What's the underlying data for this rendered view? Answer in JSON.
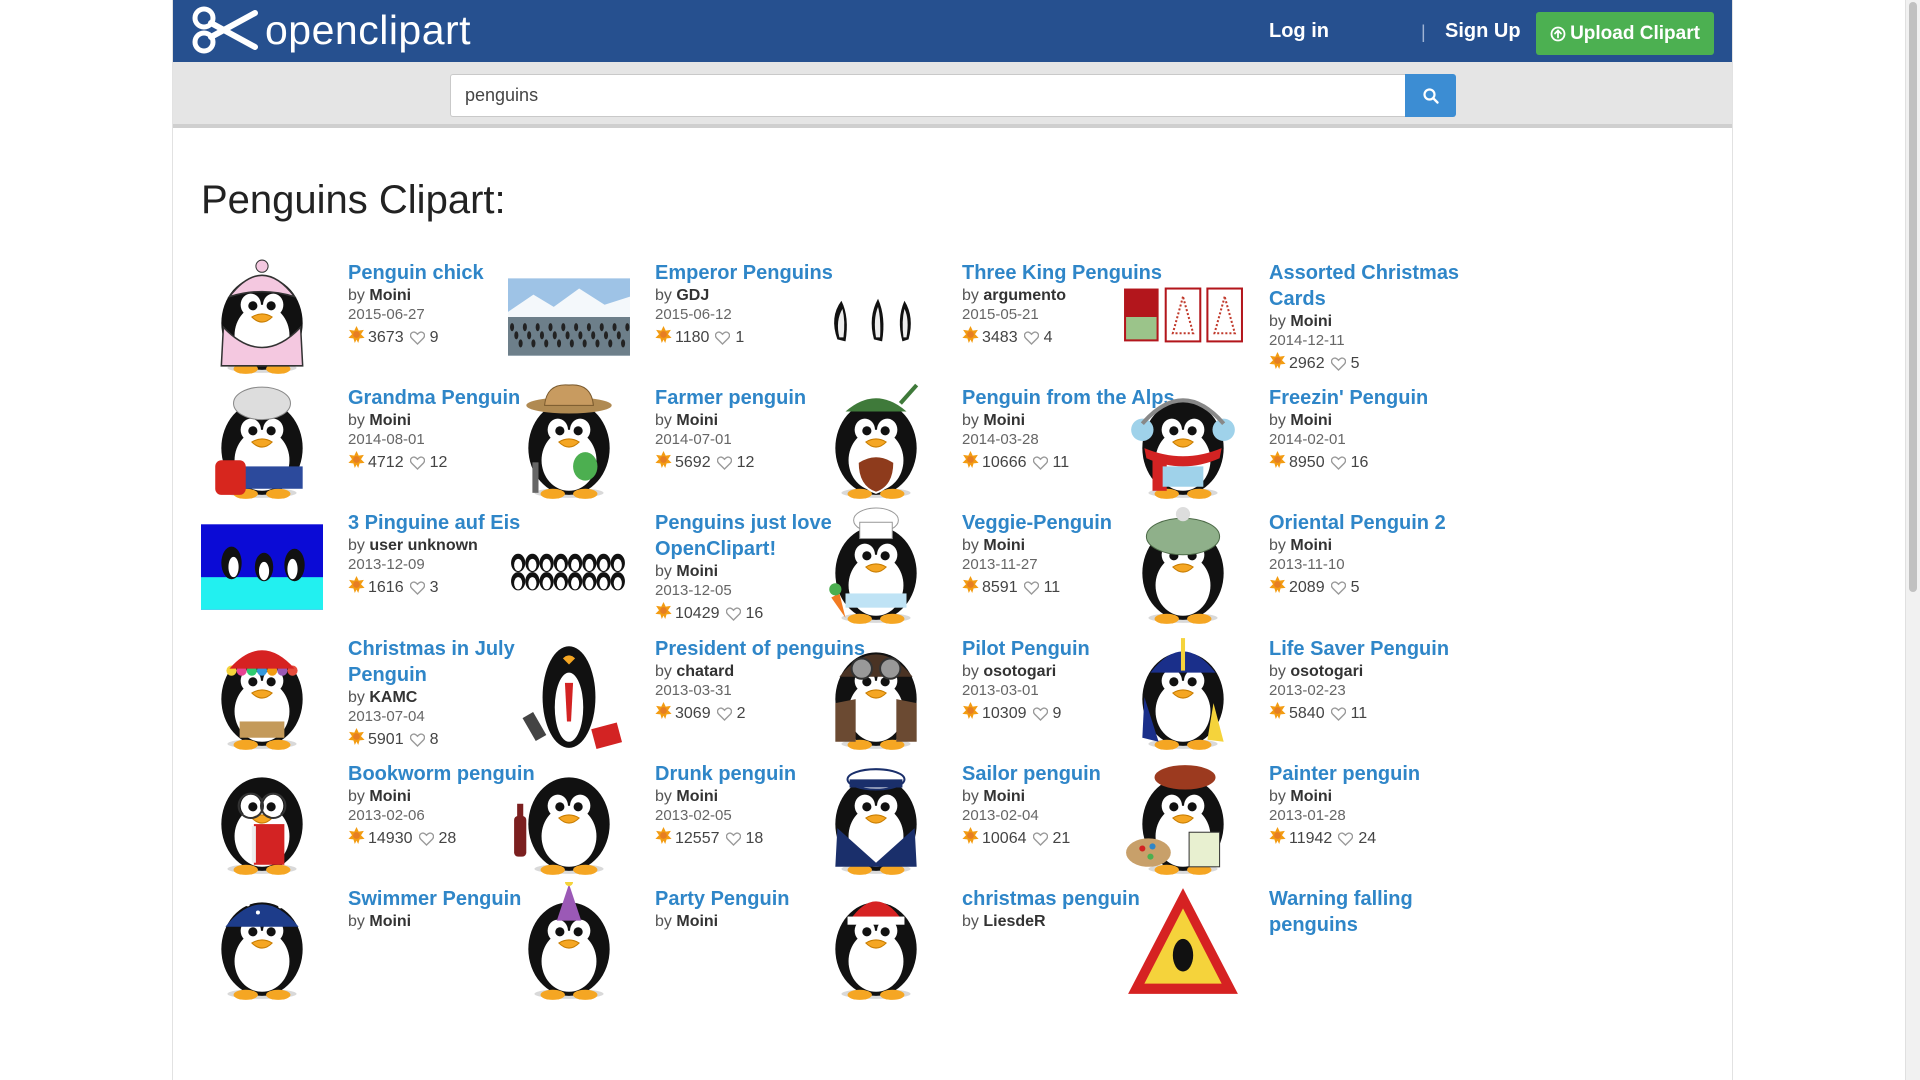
{
  "brand": {
    "name": "openclipart"
  },
  "nav": {
    "login": "Log in",
    "separator": "|",
    "signup": "Sign Up",
    "upload": "Upload Clipart"
  },
  "search": {
    "value": "penguins",
    "placeholder": ""
  },
  "page_title": "Penguins Clipart:",
  "colors": {
    "navbar": "#26508f",
    "upload": "#4cb051",
    "link": "#2f86c8",
    "search_button": "#3c8dd3"
  },
  "items": [
    {
      "title": "Penguin chick",
      "by_prefix": "by",
      "author": "Moini",
      "date": "2015-06-27",
      "downloads": "3673",
      "favorites": "9",
      "thumb": "penguin-pink-coat"
    },
    {
      "title": "Emperor Penguins",
      "by_prefix": "by",
      "author": "GDJ",
      "date": "2015-06-12",
      "downloads": "1180",
      "favorites": "1",
      "thumb": "penguin-colony-photo"
    },
    {
      "title": "Three King Penguins",
      "by_prefix": "by",
      "author": "argumento",
      "date": "2015-05-21",
      "downloads": "3483",
      "favorites": "4",
      "thumb": "three-penguin-silhouettes"
    },
    {
      "title": "Assorted Christmas Cards",
      "by_prefix": "by",
      "author": "Moini",
      "date": "2014-12-11",
      "downloads": "2962",
      "favorites": "5",
      "thumb": "christmas-cards"
    },
    {
      "title": "Grandma Penguin",
      "by_prefix": "by",
      "author": "Moini",
      "date": "2014-08-01",
      "downloads": "4712",
      "favorites": "12",
      "thumb": "penguin-grandma"
    },
    {
      "title": "Farmer penguin",
      "by_prefix": "by",
      "author": "Moini",
      "date": "2014-07-01",
      "downloads": "5692",
      "favorites": "12",
      "thumb": "penguin-farmer"
    },
    {
      "title": "Penguin from the Alps",
      "by_prefix": "by",
      "author": "Moini",
      "date": "2014-03-28",
      "downloads": "10666",
      "favorites": "11",
      "thumb": "penguin-alps"
    },
    {
      "title": "Freezin' Penguin",
      "by_prefix": "by",
      "author": "Moini",
      "date": "2014-02-01",
      "downloads": "8950",
      "favorites": "16",
      "thumb": "penguin-scarf"
    },
    {
      "title": "3 Pinguine auf Eis",
      "by_prefix": "by",
      "author": "user unknown",
      "date": "2013-12-09",
      "downloads": "1616",
      "favorites": "3",
      "thumb": "penguins-on-ice"
    },
    {
      "title": "Penguins just love OpenClipart!",
      "by_prefix": "by",
      "author": "Moini",
      "date": "2013-12-05",
      "downloads": "10429",
      "favorites": "16",
      "thumb": "penguin-crowd"
    },
    {
      "title": "Veggie-Penguin",
      "by_prefix": "by",
      "author": "Moini",
      "date": "2013-11-27",
      "downloads": "8591",
      "favorites": "11",
      "thumb": "penguin-chef"
    },
    {
      "title": "Oriental Penguin 2",
      "by_prefix": "by",
      "author": "Moini",
      "date": "2013-11-10",
      "downloads": "2089",
      "favorites": "5",
      "thumb": "penguin-turban"
    },
    {
      "title": "Christmas in July Penguin",
      "by_prefix": "by",
      "author": "KAMC",
      "date": "2013-07-04",
      "downloads": "5901",
      "favorites": "8",
      "thumb": "penguin-flower-hat"
    },
    {
      "title": "President of penguins",
      "by_prefix": "by",
      "author": "chatard",
      "date": "2013-03-31",
      "downloads": "3069",
      "favorites": "2",
      "thumb": "penguin-president"
    },
    {
      "title": "Pilot Penguin",
      "by_prefix": "by",
      "author": "osotogari",
      "date": "2013-03-01",
      "downloads": "10309",
      "favorites": "9",
      "thumb": "penguin-pilot"
    },
    {
      "title": "Life Saver Penguin",
      "by_prefix": "by",
      "author": "osotogari",
      "date": "2013-02-23",
      "downloads": "5840",
      "favorites": "11",
      "thumb": "penguin-lifesaver"
    },
    {
      "title": "Bookworm penguin",
      "by_prefix": "by",
      "author": "Moini",
      "date": "2013-02-06",
      "downloads": "14930",
      "favorites": "28",
      "thumb": "penguin-bookworm"
    },
    {
      "title": "Drunk penguin",
      "by_prefix": "by",
      "author": "Moini",
      "date": "2013-02-05",
      "downloads": "12557",
      "favorites": "18",
      "thumb": "penguin-drunk"
    },
    {
      "title": "Sailor penguin",
      "by_prefix": "by",
      "author": "Moini",
      "date": "2013-02-04",
      "downloads": "10064",
      "favorites": "21",
      "thumb": "penguin-sailor"
    },
    {
      "title": "Painter penguin",
      "by_prefix": "by",
      "author": "Moini",
      "date": "2013-01-28",
      "downloads": "11942",
      "favorites": "24",
      "thumb": "penguin-painter"
    },
    {
      "title": "Swimmer Penguin",
      "by_prefix": "by",
      "author": "Moini",
      "date": "",
      "downloads": "",
      "favorites": "",
      "thumb": "penguin-swimmer"
    },
    {
      "title": "Party Penguin",
      "by_prefix": "by",
      "author": "Moini",
      "date": "",
      "downloads": "",
      "favorites": "",
      "thumb": "penguin-party"
    },
    {
      "title": "christmas penguin",
      "by_prefix": "by",
      "author": "LiesdeR",
      "date": "",
      "downloads": "",
      "favorites": "",
      "thumb": "penguin-santa"
    },
    {
      "title": "Warning falling penguins",
      "by_prefix": "",
      "author": "",
      "date": "",
      "downloads": "",
      "favorites": "",
      "thumb": "warning-sign"
    }
  ]
}
